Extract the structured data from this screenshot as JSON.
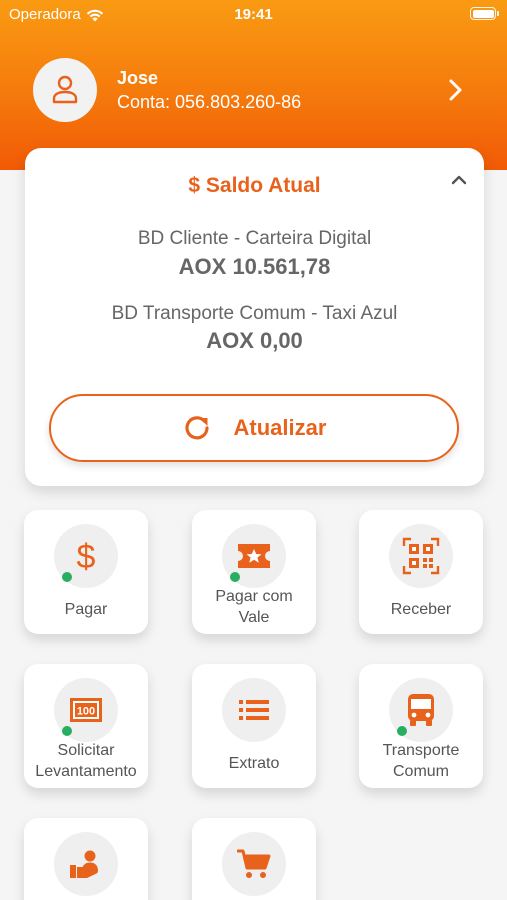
{
  "status_bar": {
    "carrier": "Operadora",
    "time": "19:41",
    "icons": [
      "wifi-icon",
      "battery-icon"
    ]
  },
  "profile": {
    "name": "Jose",
    "account": "Conta: 056.803.260-86",
    "icons": [
      "person-icon",
      "chevron-right-icon"
    ]
  },
  "balance_card": {
    "title": "$ Saldo Atual",
    "accounts": [
      {
        "label": "BD Cliente - Carteira Digital",
        "value": "AOX 10.561,78"
      },
      {
        "label": "BD Transporte Comum - Taxi Azul",
        "value": "AOX 0,00"
      }
    ],
    "refresh_label": "Atualizar",
    "icons": [
      "chevron-up-icon",
      "refresh-icon"
    ]
  },
  "actions": [
    {
      "line1": "Pagar",
      "line2": "",
      "icon": "dollar-icon",
      "active": true
    },
    {
      "line1": "Pagar com",
      "line2": "Vale",
      "icon": "ticket-icon",
      "active": true
    },
    {
      "line1": "Receber",
      "line2": "",
      "icon": "qr-code-icon",
      "active": false
    },
    {
      "line1": "Solicitar",
      "line2": "Levantamento",
      "icon": "cash-icon",
      "active": true
    },
    {
      "line1": "Extrato",
      "line2": "",
      "icon": "list-icon",
      "active": false
    },
    {
      "line1": "Transporte",
      "line2": "Comum",
      "icon": "bus-icon",
      "active": true
    },
    {
      "line1": "",
      "line2": "",
      "icon": "hand-person-icon",
      "active": false
    },
    {
      "line1": "",
      "line2": "",
      "icon": "cart-icon",
      "active": false
    }
  ],
  "colors": {
    "accent": "#e8621c",
    "header_top": "#f99b12",
    "header_bottom": "#f25a06",
    "status_dot": "#27ae60"
  }
}
